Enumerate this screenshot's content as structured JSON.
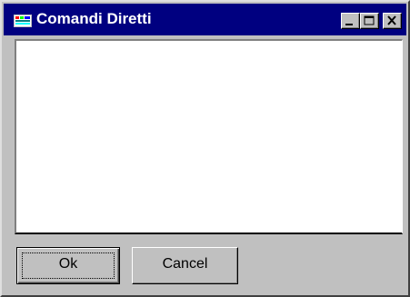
{
  "window": {
    "title": "Comandi Diretti",
    "title_bar_color": "#000080",
    "icons": {
      "app": "window-app-icon",
      "minimize": "minimize-icon",
      "maximize": "maximize-icon",
      "close": "close-icon"
    }
  },
  "content": {
    "text": ""
  },
  "buttons": {
    "ok_label": "Ok",
    "cancel_label": "Cancel"
  }
}
